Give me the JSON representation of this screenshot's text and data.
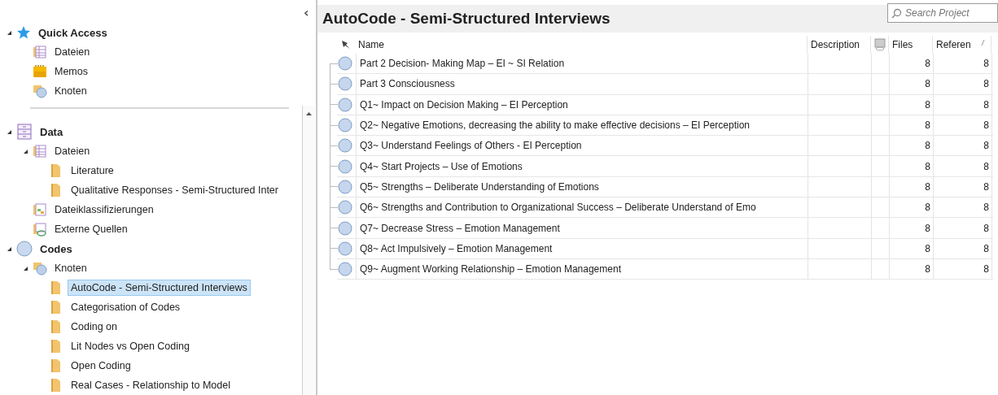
{
  "navigation": {
    "collapse_glyph": "‹",
    "sections": [
      {
        "label": "Quick Access",
        "kind": "star",
        "expanded": true,
        "selected": false,
        "children": [
          {
            "label": "Dateien",
            "kind": "files",
            "selected": false
          },
          {
            "label": "Memos",
            "kind": "memos",
            "selected": false
          },
          {
            "label": "Knoten",
            "kind": "nodes",
            "selected": false
          }
        ]
      },
      {
        "label": "Data",
        "kind": "data",
        "expanded": true,
        "selected": false,
        "children": [
          {
            "label": "Dateien",
            "kind": "files",
            "expanded": true,
            "selected": false,
            "children": [
              {
                "label": "Literature",
                "kind": "folder",
                "selected": false
              },
              {
                "label": "Qualitative Responses - Semi-Structured Inter",
                "kind": "folder",
                "selected": false
              }
            ]
          },
          {
            "label": "Dateiklassifizierungen",
            "kind": "classify",
            "selected": false
          },
          {
            "label": "Externe Quellen",
            "kind": "external",
            "selected": false
          }
        ]
      },
      {
        "label": "Codes",
        "kind": "codes",
        "expanded": true,
        "selected": false,
        "children": [
          {
            "label": "Knoten",
            "kind": "nodes",
            "expanded": true,
            "selected": false,
            "children": [
              {
                "label": "AutoCode - Semi-Structured Interviews",
                "kind": "folder",
                "selected": true
              },
              {
                "label": "Categorisation of Codes",
                "kind": "folder",
                "selected": false
              },
              {
                "label": "Coding on",
                "kind": "folder",
                "selected": false
              },
              {
                "label": "Lit Nodes vs Open Coding",
                "kind": "folder",
                "selected": false
              },
              {
                "label": "Open Coding",
                "kind": "folder",
                "selected": false
              },
              {
                "label": "Real Cases - Relationship to Model",
                "kind": "folder",
                "selected": false
              }
            ]
          }
        ]
      }
    ]
  },
  "detail": {
    "title": "AutoCode - Semi-Structured Interviews",
    "search": {
      "placeholder": "Search Project"
    },
    "table": {
      "columns": [
        {
          "kind": "text",
          "label": "Name"
        },
        {
          "kind": "text",
          "label": "Description"
        },
        {
          "kind": "icon"
        },
        {
          "kind": "text",
          "label": "Files"
        },
        {
          "kind": "text",
          "label": "Referen"
        }
      ],
      "rows": [
        {
          "name": "Part 2 Decision- Making Map – EI ~ SI Relation",
          "files": "8",
          "references": "8"
        },
        {
          "name": "Part 3 Consciousness",
          "files": "8",
          "references": "8"
        },
        {
          "name": "Q1~ Impact on Decision Making – EI Perception",
          "files": "8",
          "references": "8"
        },
        {
          "name": "Q2~ Negative Emotions, decreasing the ability to make effective decisions – EI Perception",
          "files": "8",
          "references": "8"
        },
        {
          "name": "Q3~ Understand Feelings of Others - EI Perception",
          "files": "8",
          "references": "8"
        },
        {
          "name": "Q4~ Start Projects – Use of Emotions",
          "files": "8",
          "references": "8"
        },
        {
          "name": "Q5~ Strengths – Deliberate Understanding of Emotions",
          "files": "8",
          "references": "8"
        },
        {
          "name": "Q6~ Strengths and Contribution to Organizational Success – Deliberate Understand of Emo",
          "files": "8",
          "references": "8"
        },
        {
          "name": "Q7~ Decrease Stress – Emotion Management",
          "files": "8",
          "references": "8"
        },
        {
          "name": "Q8~ Act Impulsively – Emotion Management",
          "files": "8",
          "references": "8"
        },
        {
          "name": "Q9~ Augment Working Relationship – Emotion Management",
          "files": "8",
          "references": "8"
        }
      ]
    }
  }
}
